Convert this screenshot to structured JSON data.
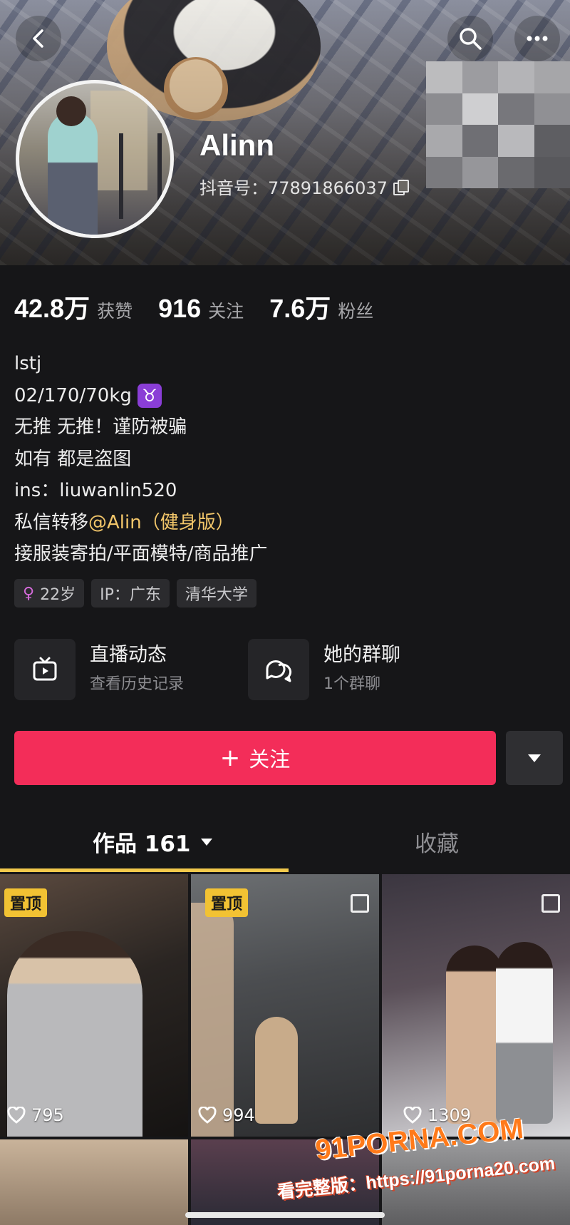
{
  "profile": {
    "name": "Alinn",
    "douyin_id": "抖音号：77891866037"
  },
  "stats": [
    {
      "value": "42.8万",
      "label": "获赞"
    },
    {
      "value": "916",
      "label": "关注"
    },
    {
      "value": "7.6万",
      "label": "粉丝"
    }
  ],
  "bio": {
    "line1": "lstj",
    "line2": "02/170/70kg",
    "zodiac": "♉",
    "line3": "无推 无推！谨防被骗",
    "line4": "如有 都是盗图",
    "line5": "ins：liuwanlin520",
    "line6_prefix": "私信转移",
    "line6_mention": "@Alin（健身版）",
    "line7": "接服装寄拍/平面模特/商品推广"
  },
  "tags": {
    "age": "22岁",
    "ip": "IP：广东",
    "school": "清华大学"
  },
  "cards": {
    "live": {
      "title": "直播动态",
      "subtitle": "查看历史记录"
    },
    "group": {
      "title": "她的群聊",
      "subtitle": "1个群聊"
    }
  },
  "follow": {
    "plus": "+",
    "label": "关注"
  },
  "tabs": {
    "works": "作品 161",
    "favorites": "收藏"
  },
  "posts": [
    {
      "pinned": "置顶",
      "likes": "795"
    },
    {
      "pinned": "置顶",
      "likes": "994"
    },
    {
      "pinned": "",
      "likes": "1309"
    }
  ],
  "watermark": {
    "logo": "91PORNA.COM",
    "url": "看完整版：https://91porna20.com"
  },
  "colors": {
    "accent": "#f32d59",
    "tab_underline": "#f2c94c",
    "pin_badge": "#f2c233",
    "mention": "#f2c66a"
  },
  "icons": {
    "back": "chevron-left-icon",
    "search": "search-icon",
    "more": "ellipsis-icon",
    "copy": "copy-icon",
    "live": "tv-icon",
    "group": "chat-bubbles-icon",
    "like": "heart-icon",
    "gender": "female-icon"
  }
}
